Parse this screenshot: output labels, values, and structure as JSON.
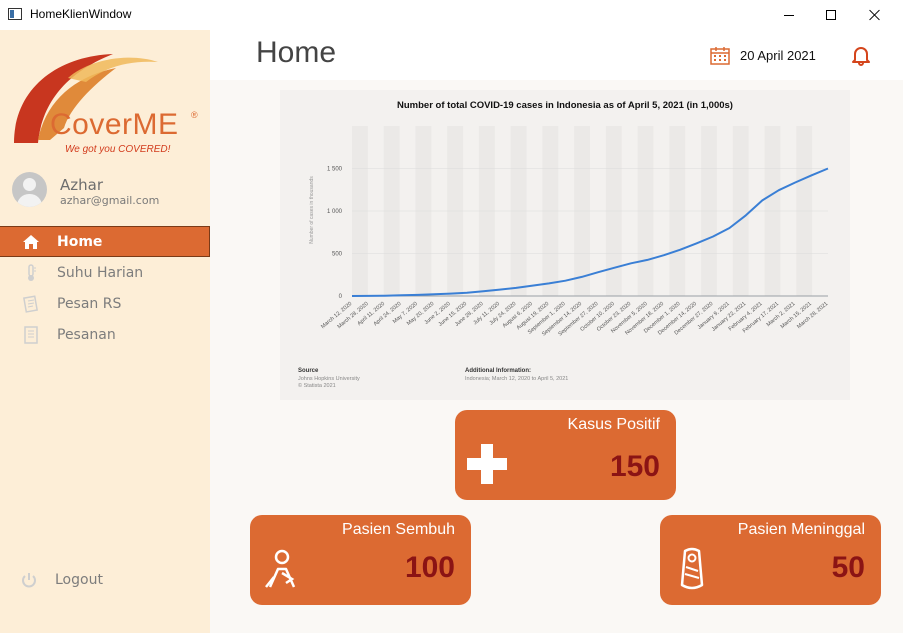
{
  "window": {
    "title": "HomeKlienWindow"
  },
  "brand": {
    "name": "CoverME",
    "registered": "®",
    "tagline": "We got you COVERED!",
    "color": "#dc6a32"
  },
  "user": {
    "name": "Azhar",
    "email": "azhar@gmail.com"
  },
  "nav": {
    "items": [
      {
        "label": "Home",
        "icon": "home-icon",
        "active": true
      },
      {
        "label": "Suhu Harian",
        "icon": "thermometer-icon",
        "active": false
      },
      {
        "label": "Pesan RS",
        "icon": "hospital-message-icon",
        "active": false
      },
      {
        "label": "Pesanan",
        "icon": "order-list-icon",
        "active": false
      }
    ],
    "logout": {
      "label": "Logout",
      "icon": "power-icon"
    }
  },
  "header": {
    "title": "Home",
    "date": "20 April 2021",
    "calendar_icon": "calendar-icon",
    "bell_icon": "bell-icon"
  },
  "chart_data": {
    "type": "line",
    "title": "Number of total COVID-19 cases in Indonesia as of April 5, 2021 (in 1,000s)",
    "ylabel": "Number of cases in thousands",
    "xlabel": "",
    "ylim": [
      0,
      2000
    ],
    "yticks": [
      "0",
      "500",
      "1 000",
      "1 500"
    ],
    "grid": true,
    "categories": [
      "March 12, 2020",
      "March 28, 2020",
      "April 11, 2020",
      "April 24, 2020",
      "May 7, 2020",
      "May 20, 2020",
      "June 2, 2020",
      "June 15, 2020",
      "June 28, 2020",
      "July 11, 2020",
      "July 24, 2020",
      "August 6, 2020",
      "August 19, 2020",
      "September 1, 2020",
      "September 14, 2020",
      "September 27, 2020",
      "October 10, 2020",
      "October 23, 2020",
      "November 5, 2020",
      "November 18, 2020",
      "December 1, 2020",
      "December 14, 2020",
      "December 27, 2020",
      "January 9, 2021",
      "January 22, 2021",
      "February 4, 2021",
      "February 17, 2021",
      "March 2, 2021",
      "March 15, 2021",
      "March 28, 2021"
    ],
    "series": [
      {
        "color": "#3a7fd5",
        "values": [
          0,
          1,
          4,
          8,
          13,
          20,
          28,
          38,
          55,
          75,
          95,
          122,
          148,
          180,
          225,
          280,
          333,
          385,
          425,
          480,
          545,
          620,
          700,
          800,
          950,
          1125,
          1245,
          1335,
          1420,
          1500
        ]
      }
    ],
    "source_label": "Source",
    "source_lines": [
      "Johns Hopkins University",
      "© Statista 2021"
    ],
    "info_label": "Additional Information:",
    "info_text": "Indonesia; March 12, 2020 to April 5, 2021"
  },
  "stats": {
    "positif": {
      "title": "Kasus Positif",
      "value": "150",
      "icon": "plus-cross-icon"
    },
    "sembuh": {
      "title": "Pasien Sembuh",
      "value": "100",
      "icon": "recovered-person-icon"
    },
    "meninggal": {
      "title": "Pasien Meninggal",
      "value": "50",
      "icon": "shrouded-body-icon"
    }
  }
}
